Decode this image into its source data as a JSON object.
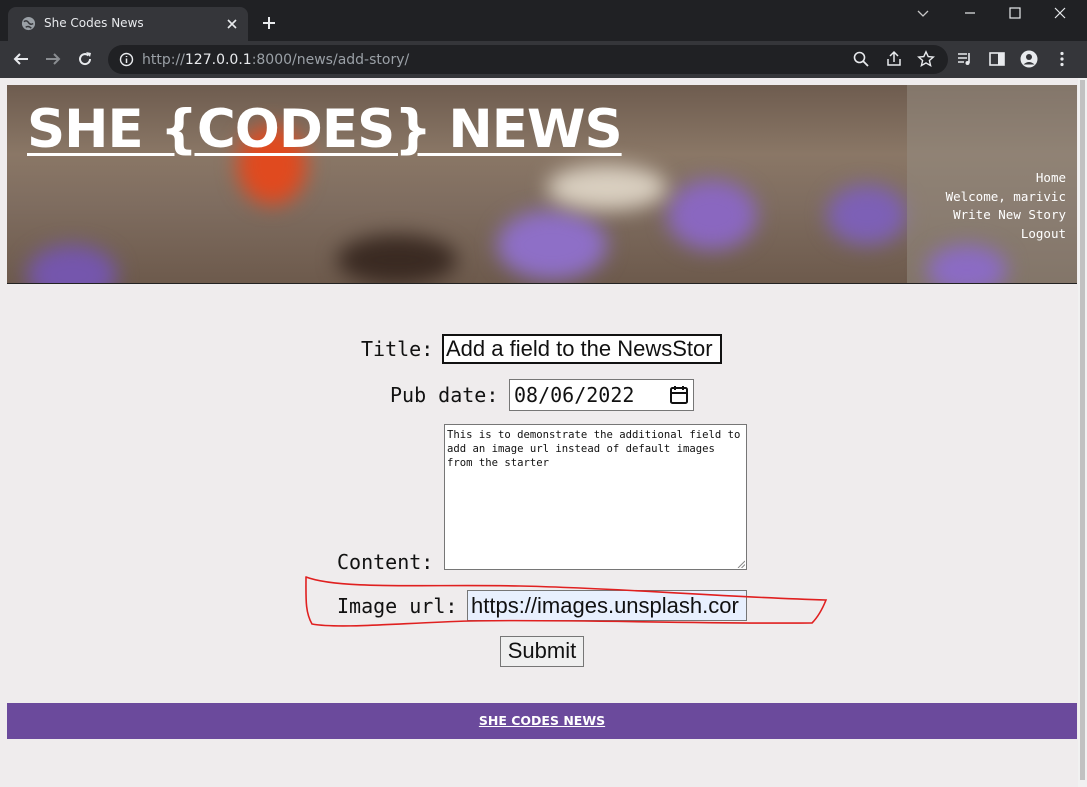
{
  "browser": {
    "tab_title": "She Codes News",
    "url_prefix": "http://",
    "url_host": "127.0.0.1",
    "url_rest": ":8000/news/add-story/"
  },
  "header": {
    "site_title": "SHE {CODES} NEWS",
    "nav": {
      "home": "Home",
      "welcome": "Welcome, marivic",
      "write": "Write New Story",
      "logout": "Logout"
    }
  },
  "form": {
    "title_label": "Title:",
    "title_value": "Add a field to the NewsStor",
    "pub_date_label": "Pub date:",
    "pub_date_value": "08/06/2022",
    "content_label": "Content:",
    "content_value": "This is to demonstrate the additional field to add an image url instead of default images from the starter",
    "image_url_label": "Image url:",
    "image_url_value": "https://images.unsplash.cor",
    "submit_label": "Submit"
  },
  "footer": {
    "text": "SHE CODES NEWS"
  },
  "colors": {
    "footer_bg": "#6b4a9c",
    "annotation": "#e02020"
  }
}
